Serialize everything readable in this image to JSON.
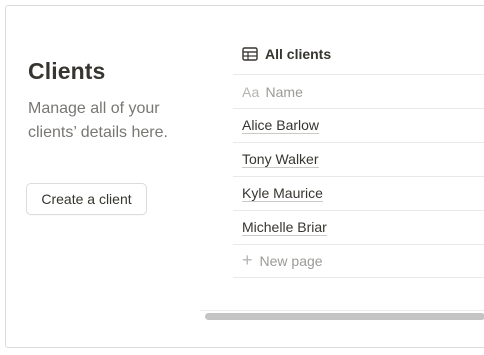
{
  "page": {
    "title": "Clients",
    "description": "Manage all of your clients’ details here.",
    "create_button": "Create a client"
  },
  "database": {
    "view_icon": "table-icon",
    "view_name": "All clients",
    "column_icon": "Aa",
    "column_header": "Name",
    "rows": [
      {
        "name": "Alice Barlow"
      },
      {
        "name": "Tony Walker"
      },
      {
        "name": "Kyle Maurice"
      },
      {
        "name": "Michelle Briar"
      }
    ],
    "new_page_label": "New page"
  },
  "colors": {
    "text": "#37352f",
    "muted": "#787774",
    "placeholder": "#9b9a97",
    "border": "#e9e9e7",
    "scrollbar": "#c4c4c4"
  }
}
